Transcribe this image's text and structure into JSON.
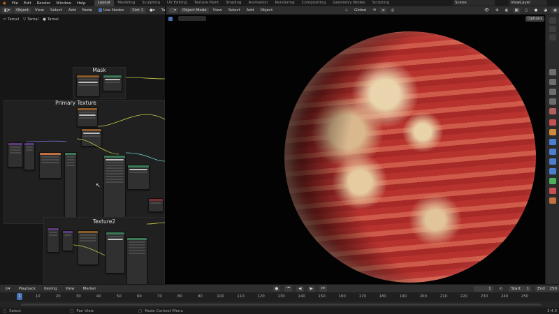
{
  "menu": [
    "File",
    "Edit",
    "Render",
    "Window",
    "Help"
  ],
  "workspaces": [
    {
      "label": "Layout",
      "active": true
    },
    {
      "label": "Modeling",
      "active": false
    },
    {
      "label": "Sculpting",
      "active": false
    },
    {
      "label": "UV Editing",
      "active": false
    },
    {
      "label": "Texture Paint",
      "active": false
    },
    {
      "label": "Shading",
      "active": false
    },
    {
      "label": "Animation",
      "active": false
    },
    {
      "label": "Rendering",
      "active": false
    },
    {
      "label": "Compositing",
      "active": false
    },
    {
      "label": "Geometry Nodes",
      "active": false
    },
    {
      "label": "Scripting",
      "active": false
    }
  ],
  "scene": "Scene",
  "view_layer": "ViewLayer",
  "node_editor": {
    "type": "Object",
    "menus": [
      "View",
      "Select",
      "Add",
      "Node"
    ],
    "use_nodes_label": "Use Nodes",
    "slot": "Slot 1",
    "material": "Tamal",
    "breadcrumb": [
      "Tamal",
      "Tamal",
      "Tamal"
    ],
    "frames": {
      "mask": "Mask",
      "primary": "Primary Texture",
      "texture2": "Texture2"
    }
  },
  "viewport": {
    "mode": "Object Mode",
    "menus": [
      "View",
      "Select",
      "Add",
      "Object"
    ],
    "orientation": "Global",
    "options": "Options"
  },
  "timeline": {
    "menus": [
      "Playback",
      "Keying",
      "View",
      "Marker"
    ],
    "current_frame": "1",
    "start_label": "Start",
    "start": "1",
    "end_label": "End",
    "end": "250",
    "ticks": [
      "1",
      "10",
      "20",
      "30",
      "40",
      "50",
      "60",
      "70",
      "80",
      "90",
      "100",
      "110",
      "120",
      "130",
      "140",
      "150",
      "160",
      "170",
      "180",
      "190",
      "200",
      "210",
      "220",
      "230",
      "240",
      "250"
    ]
  },
  "status": {
    "select": "Select",
    "pan": "Pan View",
    "context": "Node Context Menu",
    "version": "3.4.0"
  },
  "colors": {
    "accent": "#4772b3",
    "planet_red": "#b8342d",
    "planet_cream": "#e8d2a8"
  }
}
